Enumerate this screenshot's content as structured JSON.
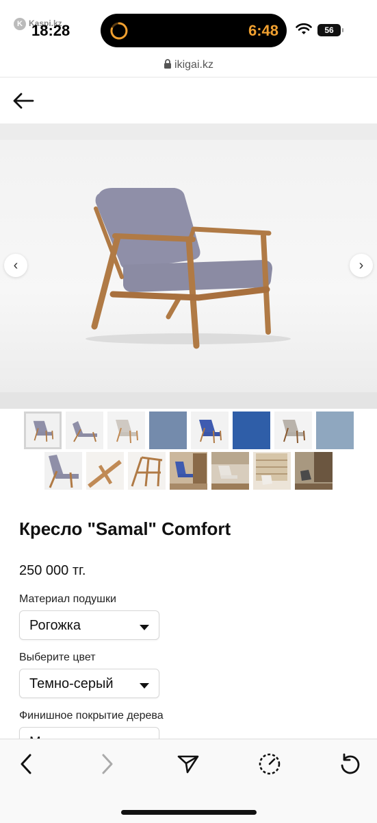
{
  "status_bar": {
    "back_app": "Kaspi.kz",
    "time": "18:28",
    "island_time": "6:48",
    "battery": "56",
    "url": "ikigai.kz"
  },
  "icons": {
    "back": "arrow-left-icon",
    "lock": "lock-icon",
    "wifi": "wifi-icon",
    "timer": "timer-icon",
    "prev": "chevron-left-icon",
    "next": "chevron-right-icon",
    "share": "send-icon",
    "speed": "speedometer-icon",
    "reload": "reload-icon"
  },
  "carousel": {
    "prev_label": "‹",
    "next_label": "›"
  },
  "thumbnails_row1": [
    "chair-grey-front",
    "chair-grey-side",
    "chair-beige",
    "fabric-grey-blue",
    "chair-blue",
    "fabric-blue",
    "chair-beige-2",
    "fabric-light-blue"
  ],
  "thumbnails_row2": [
    "chair-grey-angle",
    "detail-wood",
    "frame-wood",
    "interior-shelves",
    "interior-room",
    "interior-bookcase",
    "interior-dark"
  ],
  "product": {
    "title": "Кресло \"Samal\" Comfort",
    "price": "250 000 тг."
  },
  "options": [
    {
      "label": "Материал подушки",
      "value": "Рогожка"
    },
    {
      "label": "Выберите цвет",
      "value": "Темно-серый"
    },
    {
      "label": "Финишное покрытие дерева",
      "value": "М"
    }
  ],
  "colors": {
    "fabric": "#8f8fa8",
    "wood": "#b07a45",
    "accent_timer": "#f0a030"
  }
}
